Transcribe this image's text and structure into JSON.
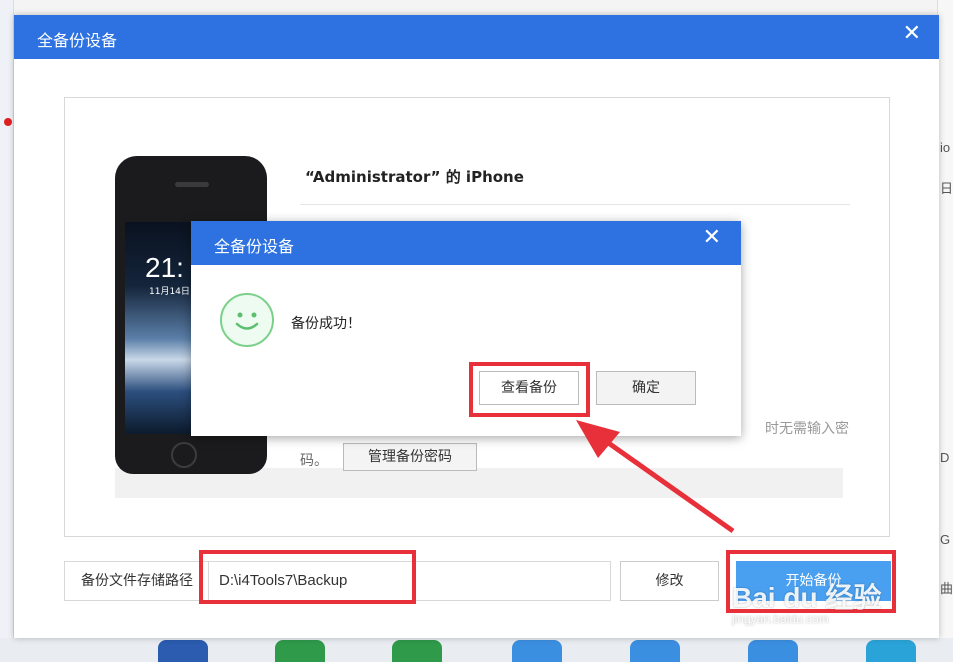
{
  "main_dialog": {
    "title": "全备份设备",
    "close_glyph": "✕",
    "device_name": "“Administrator” 的 iPhone",
    "phone": {
      "time": "21:",
      "date": "11月14日"
    },
    "obscured_text": "时无需输入密",
    "password_note": "码。",
    "manage_password_button": "管理备份密码",
    "path_label": "备份文件存储路径",
    "path_value": "D:\\i4Tools7\\Backup",
    "modify_button": "修改",
    "start_button": "开始备份"
  },
  "modal": {
    "title": "全备份设备",
    "close_glyph": "✕",
    "message": "备份成功！",
    "icon": "smile-icon",
    "view_backup_button": "查看备份",
    "ok_button": "确定"
  },
  "background_right": [
    "io",
    "日",
    "D",
    "G",
    "曲"
  ],
  "watermark": {
    "brand": "Bai du 经验",
    "url": "jingyan.baidu.com"
  },
  "colors": {
    "titlebar": "#2d72e0",
    "annotation": "#e8303a",
    "success_green": "#7bd08a"
  }
}
